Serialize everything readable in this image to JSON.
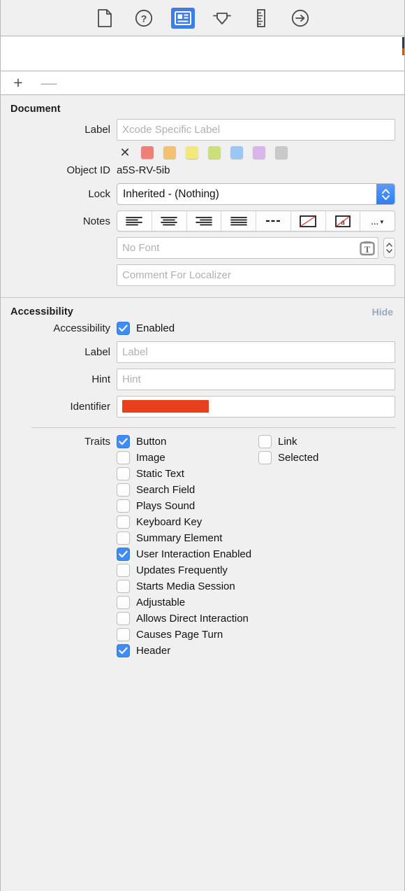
{
  "toolbar": {
    "items": [
      {
        "name": "file-inspector-icon",
        "title": "File Inspector",
        "selected": false
      },
      {
        "name": "quick-help-icon",
        "title": "Quick Help Inspector",
        "selected": false
      },
      {
        "name": "identity-inspector-icon",
        "title": "Identity Inspector",
        "selected": true
      },
      {
        "name": "attributes-inspector-icon",
        "title": "Attributes Inspector",
        "selected": false
      },
      {
        "name": "size-inspector-icon",
        "title": "Size Inspector",
        "selected": false
      },
      {
        "name": "connections-inspector-icon",
        "title": "Connections Inspector",
        "selected": false
      }
    ]
  },
  "list_toolbar": {
    "add_label": "+",
    "remove_label": "—"
  },
  "document": {
    "title": "Document",
    "label_row": {
      "label": "Label",
      "value": "",
      "placeholder": "Xcode Specific Label"
    },
    "swatches": {
      "clear_label": "✕",
      "colors": [
        "#ef8076",
        "#f2c173",
        "#f2e87e",
        "#cbe07b",
        "#9bc7f5",
        "#d9b6ea",
        "#c9c9c9"
      ]
    },
    "object_id_row": {
      "label": "Object ID",
      "value": "a5S-RV-5ib"
    },
    "lock_row": {
      "label": "Lock",
      "value": "Inherited - (Nothing)"
    },
    "notes_row": {
      "label": "Notes",
      "segments": [
        {
          "name": "align-left-icon"
        },
        {
          "name": "align-center-icon"
        },
        {
          "name": "align-right-icon"
        },
        {
          "name": "align-justify-icon"
        },
        {
          "name": "dashes-icon"
        },
        {
          "name": "no-fill-color-icon"
        },
        {
          "name": "text-color-icon",
          "glyph": "a"
        },
        {
          "name": "more-options-icon",
          "glyph": "..."
        }
      ]
    },
    "font_row": {
      "value": "",
      "placeholder": "No Font"
    },
    "comment_row": {
      "value": "",
      "placeholder": "Comment For Localizer"
    }
  },
  "accessibility": {
    "title": "Accessibility",
    "hide_label": "Hide",
    "enabled_row": {
      "label": "Accessibility",
      "checkbox_label": "Enabled",
      "checked": true
    },
    "label_row": {
      "label": "Label",
      "value": "",
      "placeholder": "Label"
    },
    "hint_row": {
      "label": "Hint",
      "value": "",
      "placeholder": "Hint"
    },
    "identifier_row": {
      "label": "Identifier",
      "value": "",
      "redacted": true,
      "redaction_color": "#e8401f"
    },
    "traits": {
      "label": "Traits",
      "left_column": [
        {
          "label": "Button",
          "checked": true
        },
        {
          "label": "Image",
          "checked": false
        },
        {
          "label": "Static Text",
          "checked": false
        },
        {
          "label": "Search Field",
          "checked": false
        },
        {
          "label": "Plays Sound",
          "checked": false
        },
        {
          "label": "Keyboard Key",
          "checked": false
        },
        {
          "label": "Summary Element",
          "checked": false
        },
        {
          "label": "User Interaction Enabled",
          "checked": true
        },
        {
          "label": "Updates Frequently",
          "checked": false
        },
        {
          "label": "Starts Media Session",
          "checked": false
        },
        {
          "label": "Adjustable",
          "checked": false
        },
        {
          "label": "Allows Direct Interaction",
          "checked": false
        },
        {
          "label": "Causes Page Turn",
          "checked": false
        },
        {
          "label": "Header",
          "checked": true
        }
      ],
      "right_column": [
        {
          "label": "Link",
          "checked": false
        },
        {
          "label": "Selected",
          "checked": false
        }
      ]
    }
  },
  "colors": {
    "accent": "#3b7de9",
    "checkbox_checked": "#3f8cf5",
    "panel_background": "#f0f0f0",
    "hide_link": "#9aa8bc"
  }
}
